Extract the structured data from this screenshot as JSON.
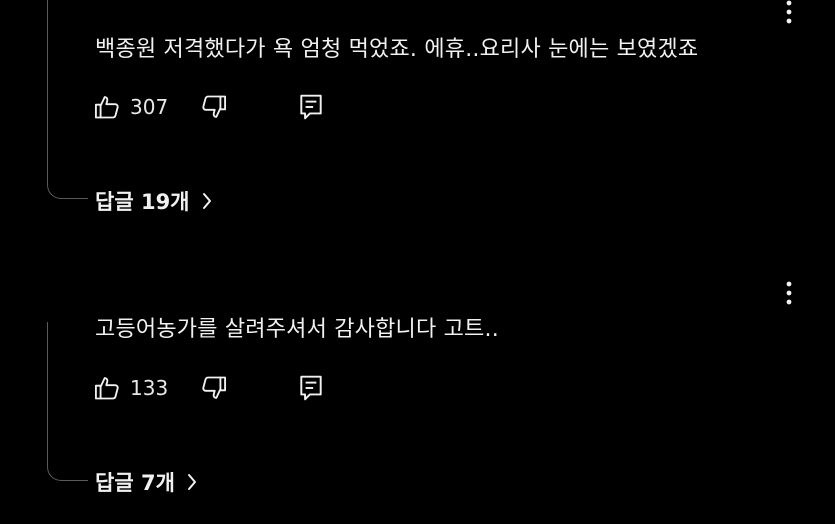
{
  "comments": [
    {
      "text": "백종원 저격했다가 욕 엄청 먹었죠. 에휴..요리사 눈에는 보였겠죠",
      "likes": "307",
      "replies_label": "답글 19개"
    },
    {
      "text": "고등어농가를 살려주셔서 감사합니다 고트..",
      "likes": "133",
      "replies_label": "답글 7개"
    }
  ],
  "icons": {
    "like": "thumbs-up-icon",
    "dislike": "thumbs-down-icon",
    "reply": "comment-reply-icon",
    "more": "more-vertical-icon",
    "chevron": "chevron-right-icon"
  },
  "colors": {
    "background": "#000000",
    "text": "#f1f1f1",
    "thread_line": "#5a5a5a"
  }
}
